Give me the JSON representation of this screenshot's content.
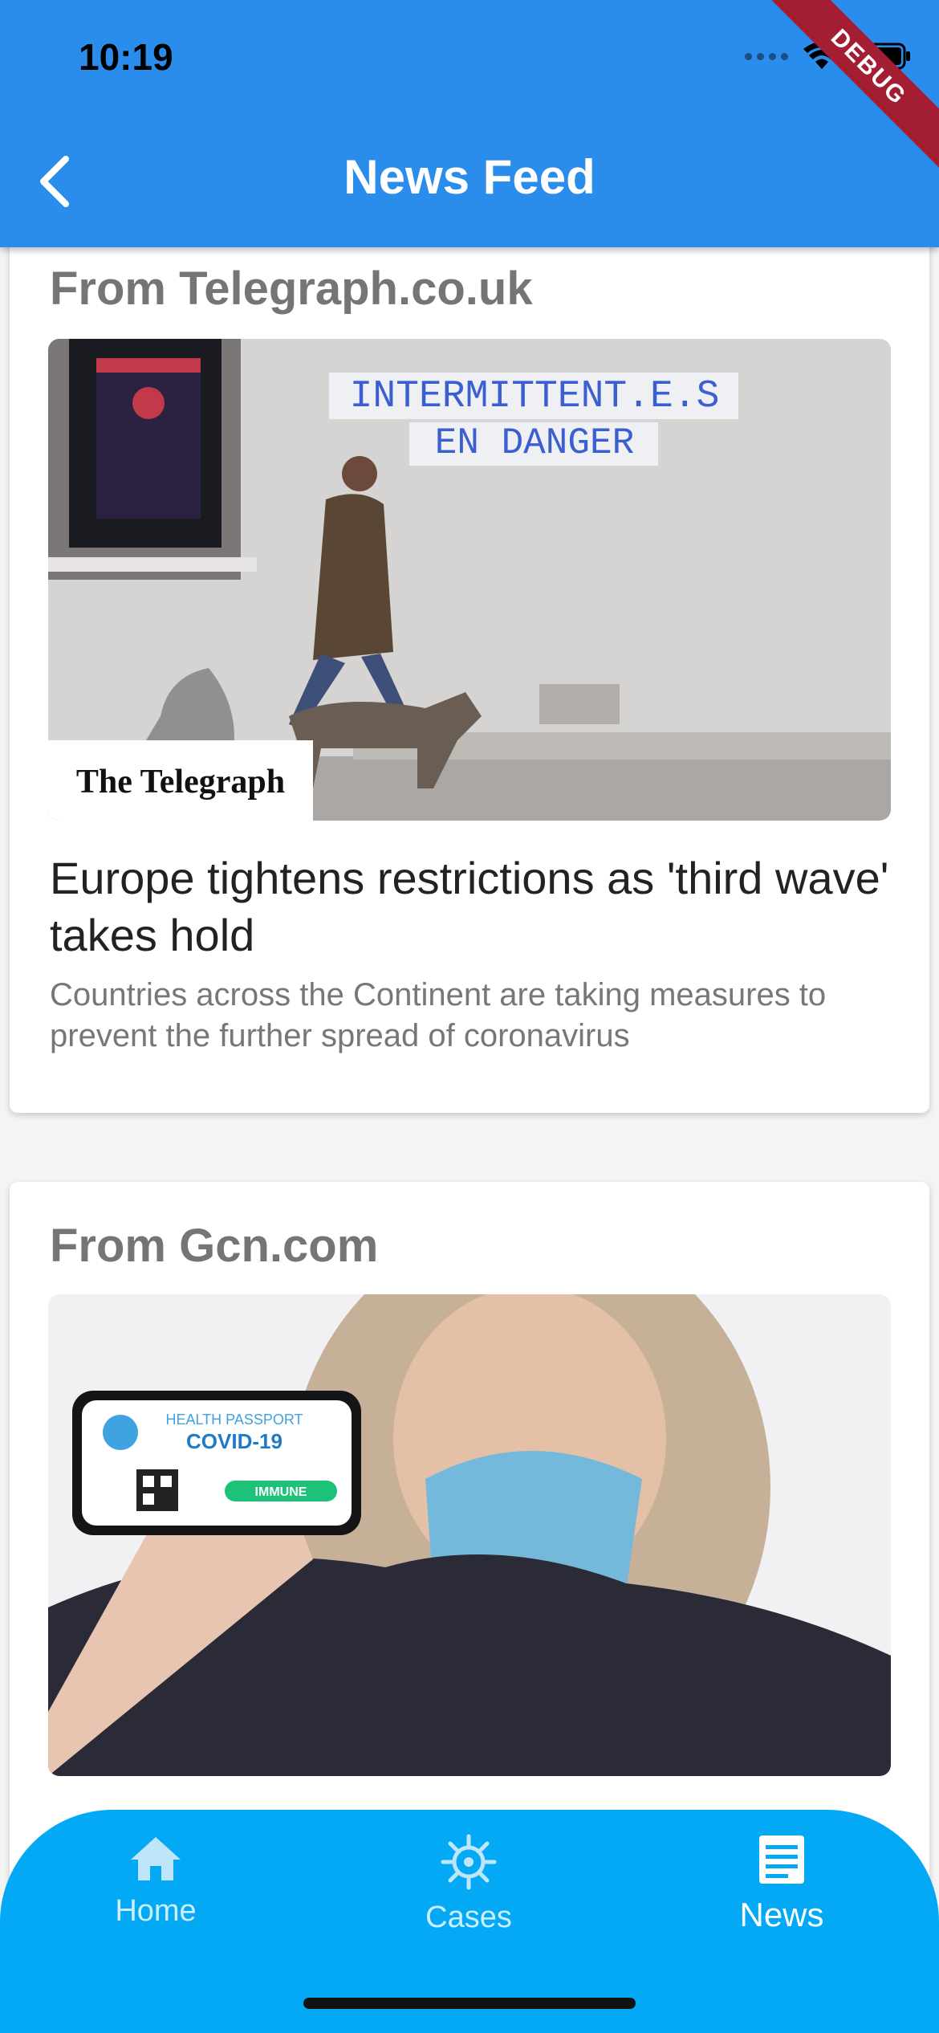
{
  "status_bar": {
    "time": "10:19"
  },
  "app_bar": {
    "title": "News Feed",
    "back_icon": "chevron-left-icon",
    "debug_banner": "DEBUG"
  },
  "articles": [
    {
      "source": "From Telegraph.co.uk",
      "image": "Woman in mask walking a dog past wall with sign",
      "image_wall_text": [
        "INTERMITTENT.E.S",
        "EN DANGER"
      ],
      "image_logo": "The Telegraph",
      "headline": "Europe tightens restrictions as 'third wave' takes hold",
      "description": "Countries across the Continent are taking measures to prevent the further spread of coronavirus"
    },
    {
      "source": "From Gcn.com",
      "image": "Masked woman holding a phone with health passport",
      "image_card": {
        "line1": "HEALTH PASSPORT",
        "line2": "COVID-19",
        "badge": "IMMUNE"
      }
    }
  ],
  "bottom_nav": {
    "items": [
      {
        "label": "Home",
        "icon": "home-icon",
        "active": false
      },
      {
        "label": "Cases",
        "icon": "virus-icon",
        "active": false
      },
      {
        "label": "News",
        "icon": "news-icon",
        "active": true
      }
    ]
  },
  "colors": {
    "app_bar": "#2a8ceb",
    "bottom_nav": "#03a9f4",
    "debug": "#a31d33"
  }
}
